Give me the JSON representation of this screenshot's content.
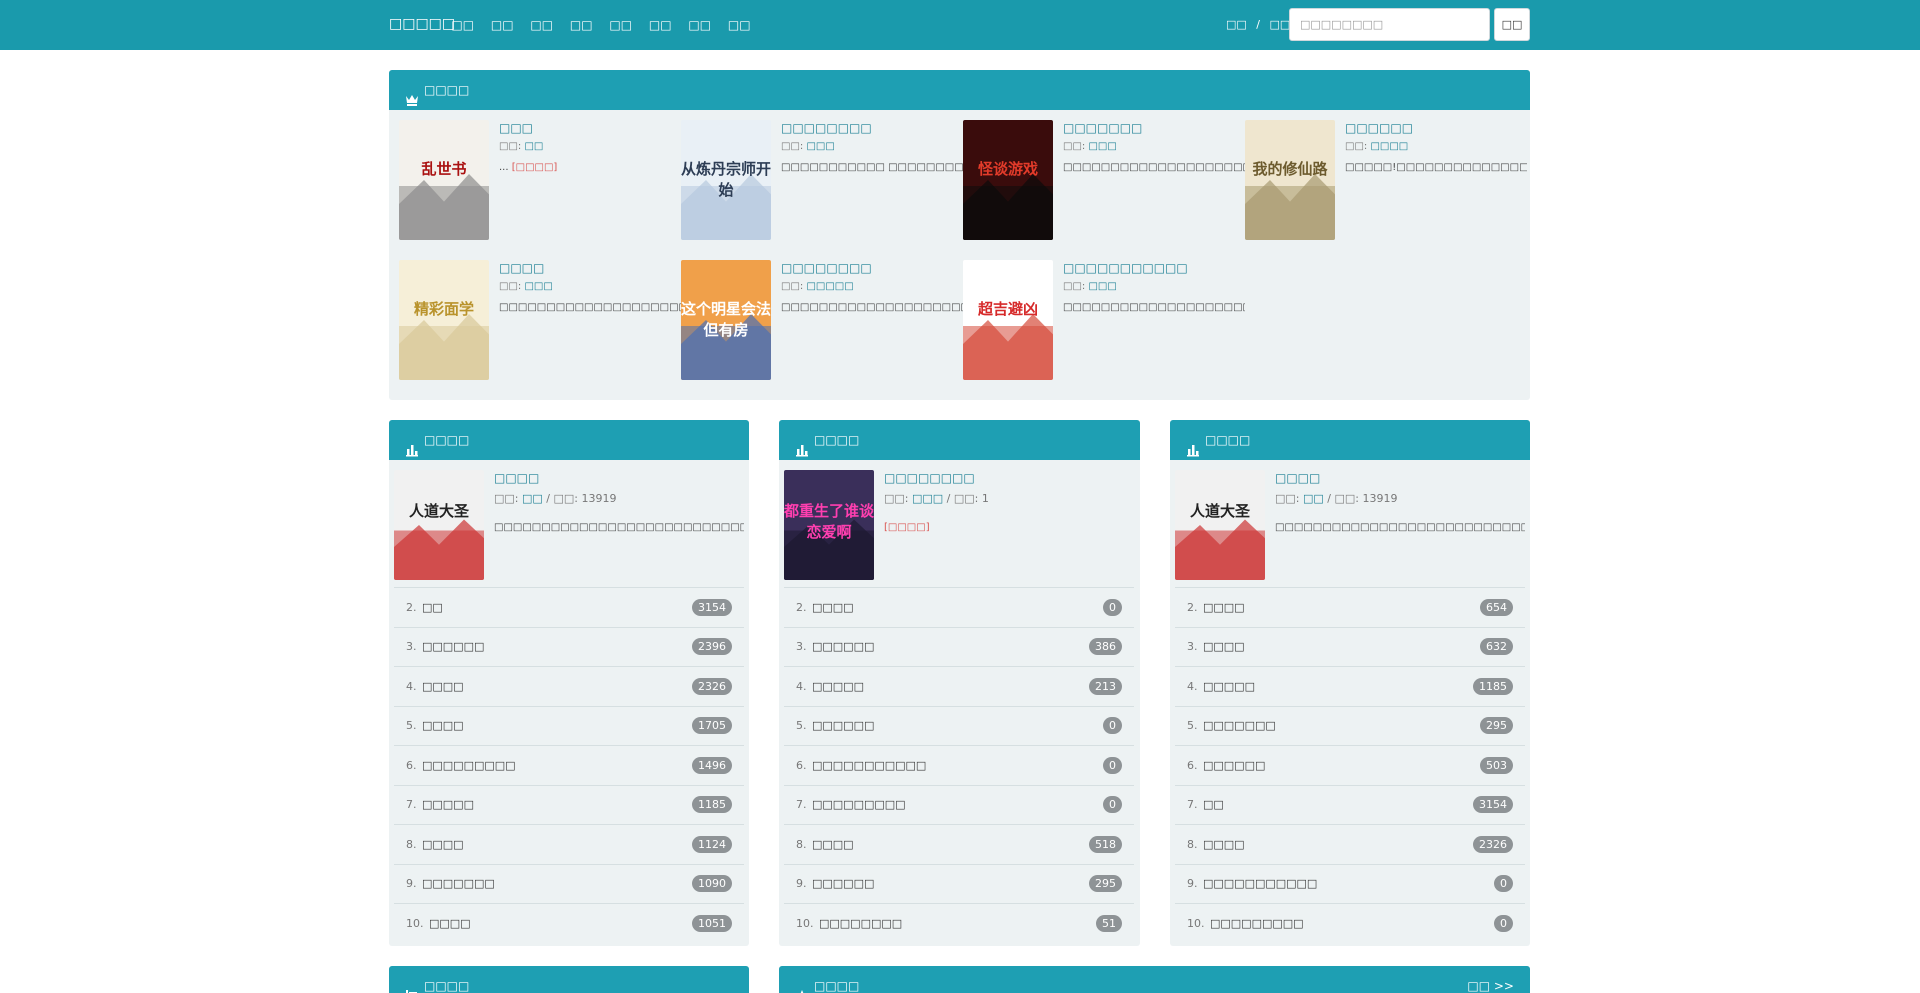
{
  "nav": {
    "brand": "□□□□□",
    "links": [
      "□□",
      "□□",
      "□□",
      "□□",
      "□□",
      "□□",
      "□□",
      "□□"
    ],
    "login": "□□",
    "separator": "/",
    "register": "□□",
    "search_placeholder": "□□□□□□□□",
    "search_button": "□□"
  },
  "recommend": {
    "title": "□□□□",
    "icon": "crown-icon",
    "detail_label": "[□□□□]",
    "author_prefix": "□□: ",
    "items": [
      {
        "title": "□□□",
        "author": "□□",
        "desc": "...",
        "cover": {
          "text": "乱世书",
          "bg1": "#f3f1ec",
          "bg2": "#8d8d8d",
          "color": "#a11"
        }
      },
      {
        "title": "□□□□□□□□",
        "author": "□□□",
        "desc": "□□□□□□□□□□□ □□□□□□□□□...",
        "cover": {
          "text": "从炼丹宗师开始",
          "bg1": "#e9f0f6",
          "bg2": "#b7c9de",
          "color": "#2d3d55"
        }
      },
      {
        "title": "□□□□□□□",
        "author": "□□□",
        "desc": "□□□□□□□□□□□□□□□□□□□□□□□□□□...",
        "cover": {
          "text": "怪谈游戏",
          "bg1": "#3a0c0c",
          "bg2": "#0c0c0c",
          "color": "#e23b2a"
        }
      },
      {
        "title": "□□□□□□",
        "author": "□□□□",
        "desc": "□□□□□!□□□□□□□□□□□□□□□□□□□□...",
        "cover": {
          "text": "我的修仙路",
          "bg1": "#efe6cf",
          "bg2": "#a89a70",
          "color": "#6d5b2e"
        }
      },
      {
        "title": "□□□□",
        "author": "□□□",
        "desc": "□□□□□□□□□□□□□□□□□□□□□□□□□□...",
        "cover": {
          "text": "精彩面学",
          "bg1": "#f6efd8",
          "bg2": "#d8c99a",
          "color": "#b9932c"
        }
      },
      {
        "title": "□□□□□□□□",
        "author": "□□□□□",
        "desc": "□□□□□□□□□□□□□□□□□□□□□□□□□□...",
        "cover": {
          "text": "这个明星会法但有房",
          "bg1": "#f0a04a",
          "bg2": "#4b6fb3",
          "color": "#ffffff"
        }
      },
      {
        "title": "□□□□□□□□□□□",
        "author": "□□□",
        "desc": "□□□□□□□□□□□□□□□□□□□□□“□□□...",
        "cover": {
          "text": "超吉避凶",
          "bg1": "#ffffff",
          "bg2": "#d64b3a",
          "color": "#d62a2a"
        }
      }
    ]
  },
  "rank_panels": [
    {
      "title": "□□□□",
      "icon": "bar-chart-icon",
      "top": {
        "title": "□□□□",
        "author_prefix": "□□: ",
        "author": "□□",
        "count_label": " / □□: ",
        "count": "13919",
        "desc": "□□□□□□□□□□□□□□□□□□□□□□□□□□□□□□",
        "detail": "[□□□□]",
        "cover": {
          "text": "人道大圣",
          "bg1": "#f1f1f1",
          "bg2": "#c33",
          "color": "#222"
        }
      },
      "rows": [
        {
          "num": "2.",
          "title": "□□",
          "count": "3154"
        },
        {
          "num": "3.",
          "title": "□□□□□□",
          "count": "2396"
        },
        {
          "num": "4.",
          "title": "□□□□",
          "count": "2326"
        },
        {
          "num": "5.",
          "title": "□□□□",
          "count": "1705"
        },
        {
          "num": "6.",
          "title": "□□□□□□□□□",
          "count": "1496"
        },
        {
          "num": "7.",
          "title": "□□□□□",
          "count": "1185"
        },
        {
          "num": "8.",
          "title": "□□□□",
          "count": "1124"
        },
        {
          "num": "9.",
          "title": "□□□□□□□",
          "count": "1090"
        },
        {
          "num": "10.",
          "title": "□□□□",
          "count": "1051"
        }
      ]
    },
    {
      "title": "□□□□",
      "icon": "bar-chart-icon",
      "top": {
        "title": "□□□□□□□□",
        "author_prefix": "□□: ",
        "author": "□□□",
        "count_label": " / □□: ",
        "count": "1",
        "desc": "",
        "detail": "[□□□□]",
        "cover": {
          "text": "都重生了谁谈恋爱啊",
          "bg1": "#3a2f5a",
          "bg2": "#1c1830",
          "color": "#ff3fb0"
        }
      },
      "rows": [
        {
          "num": "2.",
          "title": "□□□□",
          "count": "0"
        },
        {
          "num": "3.",
          "title": "□□□□□□",
          "count": "386"
        },
        {
          "num": "4.",
          "title": "□□□□□",
          "count": "213"
        },
        {
          "num": "5.",
          "title": "□□□□□□",
          "count": "0"
        },
        {
          "num": "6.",
          "title": "□□□□□□□□□□□",
          "count": "0"
        },
        {
          "num": "7.",
          "title": "□□□□□□□□□",
          "count": "0"
        },
        {
          "num": "8.",
          "title": "□□□□",
          "count": "518"
        },
        {
          "num": "9.",
          "title": "□□□□□□",
          "count": "295"
        },
        {
          "num": "10.",
          "title": "□□□□□□□□",
          "count": "51"
        }
      ]
    },
    {
      "title": "□□□□",
      "icon": "bar-chart-icon",
      "top": {
        "title": "□□□□",
        "author_prefix": "□□: ",
        "author": "□□",
        "count_label": " / □□: ",
        "count": "13919",
        "desc": "□□□□□□□□□□□□□□□□□□□□□□□□□□□□□□",
        "detail": "[□□□□]",
        "cover": {
          "text": "人道大圣",
          "bg1": "#f1f1f1",
          "bg2": "#c33",
          "color": "#222"
        }
      },
      "rows": [
        {
          "num": "2.",
          "title": "□□□□",
          "count": "654"
        },
        {
          "num": "3.",
          "title": "□□□□",
          "count": "632"
        },
        {
          "num": "4.",
          "title": "□□□□□",
          "count": "1185"
        },
        {
          "num": "5.",
          "title": "□□□□□□□",
          "count": "295"
        },
        {
          "num": "6.",
          "title": "□□□□□□",
          "count": "503"
        },
        {
          "num": "7.",
          "title": "□□",
          "count": "3154"
        },
        {
          "num": "8.",
          "title": "□□□□",
          "count": "2326"
        },
        {
          "num": "9.",
          "title": "□□□□□□□□□□□",
          "count": "0"
        },
        {
          "num": "10.",
          "title": "□□□□□□□□□",
          "count": "0"
        }
      ]
    }
  ],
  "bottom_panels": [
    {
      "title": "□□□□",
      "icon": "tag-list-icon"
    },
    {
      "title": "□□□□",
      "icon": "star-icon",
      "more": "□□ >>"
    }
  ],
  "colors": {
    "header": "#1a9aac",
    "panel_head": "#1e9fb3",
    "panel_bg": "#edf2f3",
    "link": "#1a7f93",
    "detail": "#d9534f",
    "badge": "#8e9396"
  }
}
